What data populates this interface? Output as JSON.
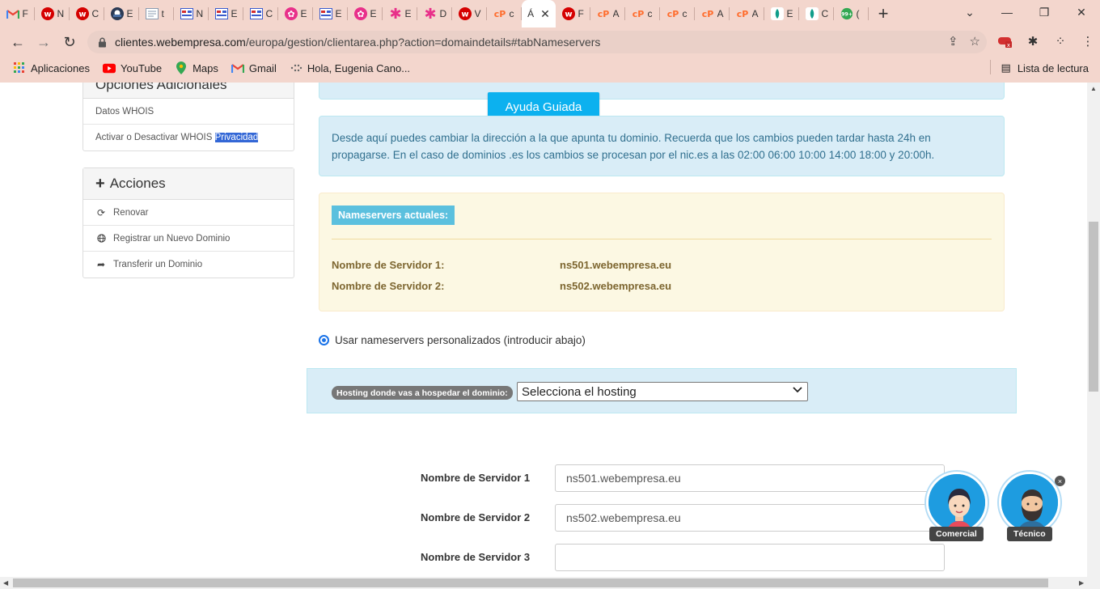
{
  "browser": {
    "tabs": [
      {
        "icon": "gmail-icon",
        "letter": "F",
        "color": "#ffffff"
      },
      {
        "icon": "webempresa-icon",
        "letter": "N",
        "color": "#d50000"
      },
      {
        "icon": "webempresa-icon",
        "letter": "C",
        "color": "#d50000"
      },
      {
        "icon": "avatar-icon",
        "letter": "E",
        "color": "#2b3a55"
      },
      {
        "icon": "document-icon",
        "letter": "t",
        "color": "#8a9bb0"
      },
      {
        "icon": "form-icon",
        "letter": "N",
        "color": "#3b5bcc"
      },
      {
        "icon": "form-icon",
        "letter": "E",
        "color": "#3b5bcc"
      },
      {
        "icon": "form-icon",
        "letter": "C",
        "color": "#3b5bcc"
      },
      {
        "icon": "flower-icon",
        "letter": "E",
        "color": "#e8308a"
      },
      {
        "icon": "form-icon",
        "letter": "E",
        "color": "#3b5bcc"
      },
      {
        "icon": "flower-icon",
        "letter": "E",
        "color": "#e8308a"
      },
      {
        "icon": "asterisk-icon",
        "letter": "E",
        "color": "#e8308a"
      },
      {
        "icon": "asterisk-icon",
        "letter": "D",
        "color": "#e8308a"
      },
      {
        "icon": "webempresa-icon",
        "letter": "V",
        "color": "#d50000"
      },
      {
        "icon": "cpanel-icon",
        "letter": "c",
        "color": "#ff6c2c"
      }
    ],
    "active_tab": {
      "letter": "Á"
    },
    "tabs_after": [
      {
        "icon": "webempresa-icon",
        "letter": "F",
        "color": "#d50000"
      },
      {
        "icon": "cpanel-icon",
        "letter": "A",
        "color": "#ff6c2c"
      },
      {
        "icon": "cpanel-icon",
        "letter": "c",
        "color": "#ff6c2c"
      },
      {
        "icon": "cpanel-icon",
        "letter": "c",
        "color": "#ff6c2c"
      },
      {
        "icon": "cpanel-icon",
        "letter": "A",
        "color": "#ff6c2c"
      },
      {
        "icon": "cpanel-icon",
        "letter": "A",
        "color": "#ff6c2c"
      },
      {
        "icon": "leaf-icon",
        "letter": "E",
        "color": "#0f9d8a"
      },
      {
        "icon": "leaf-icon",
        "letter": "C",
        "color": "#0f9d8a"
      },
      {
        "icon": "badge-icon",
        "letter": "(",
        "color": "#34a853"
      }
    ],
    "badge_count": "99+",
    "url_host": "clientes.webempresa.com",
    "url_path": "/europa/gestion/clientarea.php?action=domaindetails#tabNameservers",
    "bookmarks": [
      {
        "label": "Aplicaciones",
        "icon": "apps-icon"
      },
      {
        "label": "YouTube",
        "icon": "youtube-icon"
      },
      {
        "label": "Maps",
        "icon": "maps-icon"
      },
      {
        "label": "Gmail",
        "icon": "gmail-icon"
      },
      {
        "label": "Hola, Eugenia Cano...",
        "icon": "loading-icon"
      }
    ],
    "reading_list": "Lista de lectura"
  },
  "sidebar": {
    "additional_title": "Opciones Adicionales",
    "additional_items": [
      {
        "label": "Datos WHOIS"
      },
      {
        "label": "Activar o Desactivar WHOIS ",
        "highlight": "Privacidad"
      }
    ],
    "actions_title": "Acciones",
    "action_items": [
      {
        "label": "Renovar",
        "icon": "refresh-icon"
      },
      {
        "label": "Registrar un Nuevo Dominio",
        "icon": "globe-icon"
      },
      {
        "label": "Transferir un Dominio",
        "icon": "share-arrow-icon"
      }
    ]
  },
  "main": {
    "help_button": "Ayuda Guiada",
    "info_text": "Desde aquí puedes cambiar la dirección a la que apunta tu dominio. Recuerda que los cambios pueden tardar hasta 24h en propagarse. En el caso de dominios .es los cambios se procesan por el nic.es a las 02:00 06:00 10:00 14:00 18:00 y 20:00h.",
    "current_ns_label": "Nameservers actuales:",
    "current_ns": [
      {
        "key": "Nombre de Servidor 1:",
        "value": "ns501.webempresa.eu"
      },
      {
        "key": "Nombre de Servidor 2:",
        "value": "ns502.webempresa.eu"
      }
    ],
    "custom_ns_option": "Usar nameservers personalizados (introducir abajo)",
    "hosting_label": "Hosting donde vas a hospedar el dominio:",
    "hosting_select": "Selecciona el hosting",
    "servers": [
      {
        "label": "Nombre de Servidor 1",
        "value": "ns501.webempresa.eu"
      },
      {
        "label": "Nombre de Servidor 2",
        "value": "ns502.webempresa.eu"
      },
      {
        "label": "Nombre de Servidor 3",
        "value": ""
      }
    ]
  },
  "chat": {
    "sales_label": "Comercial",
    "tech_label": "Técnico"
  }
}
